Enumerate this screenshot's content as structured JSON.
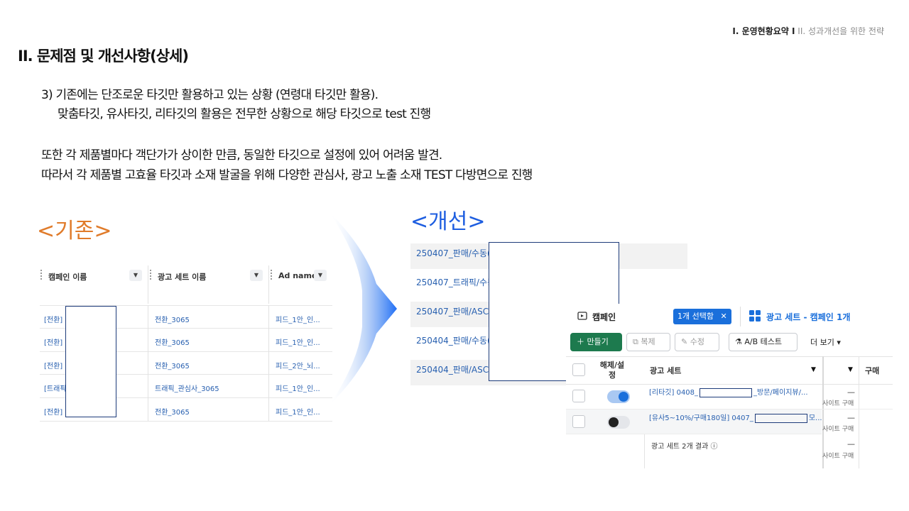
{
  "nav": {
    "current": "I. 운영현황요약 I",
    "next": "II. 성과개선을 위한 전략"
  },
  "title": "II. 문제점 및 개선사항(상세)",
  "paragraphs": {
    "line1": "3) 기존에는 단조로운 타깃만 활용하고 있는 상황 (연령대 타깃만 활용).",
    "line2": "맞춤타깃, 유사타깃, 리타깃의 활용은 전무한 상황으로 해당 타깃으로 test 진행",
    "line3": "또한 각 제품별마다 객단가가 상이한 만큼, 동일한 타깃으로 설정에 있어 어려움 발견.",
    "line4": "따라서 각 제품별 고효율 타깃과 소재 발굴을 위해 다양한 관심사, 광고 노출 소재 TEST 다방면으로 진행"
  },
  "labels": {
    "before": "<기존>",
    "after": "<개선>"
  },
  "old_table": {
    "headers": [
      "캠페인 이름",
      "광고 세트 이름",
      "Ad name"
    ],
    "rows": [
      [
        "[전환]",
        "전환_3065",
        "피드_1안_인..."
      ],
      [
        "[전환]",
        "전환_3065",
        "피드_1안_인..."
      ],
      [
        "[전환]",
        "전환_3065",
        "피드_2안_뇌..."
      ],
      [
        "[트래픽",
        "트래픽_관심사_3065",
        "피드_1안_인..."
      ],
      [
        "[전환]",
        "전환_3065",
        "피드_1안_인..."
      ]
    ]
  },
  "new_list": [
    "250407_판매/수동(",
    "250407_트래픽/수동",
    "250407_판매/ASC(",
    "250404_판매/수동(",
    "250404_판매/ASC("
  ],
  "ads_panel": {
    "campaign_tab": "캠페인",
    "selected_badge": "1개 선택함",
    "adset_tab": "광고 세트 - 캠페인 1개",
    "buttons": {
      "create": "만들기",
      "duplicate": "복제",
      "edit": "수정",
      "ab_test": "A/B 테스트",
      "more": "더 보기"
    },
    "columns": {
      "toggle": "해제/설정",
      "adset": "광고 세트",
      "purchase": "구매"
    },
    "rows": [
      {
        "name": "[리타깃] 0408_",
        "suffix": "_방문/페이지뷰/...",
        "dash": "—",
        "metric": "사이트 구매",
        "on": true
      },
      {
        "name": "[유사5~10%/구매180일] 0407_",
        "suffix": "모...",
        "dash": "—",
        "metric": "사이트 구매",
        "on": false
      }
    ],
    "summary": "광고 세트 2개 결과",
    "summary_dash": "—",
    "summary_metric": "사이트 구매"
  },
  "colors": {
    "accent_orange": "#e07b2a",
    "accent_blue": "#1e5ee0",
    "meta_green": "#1d7a4e",
    "link": "#2860b0"
  }
}
